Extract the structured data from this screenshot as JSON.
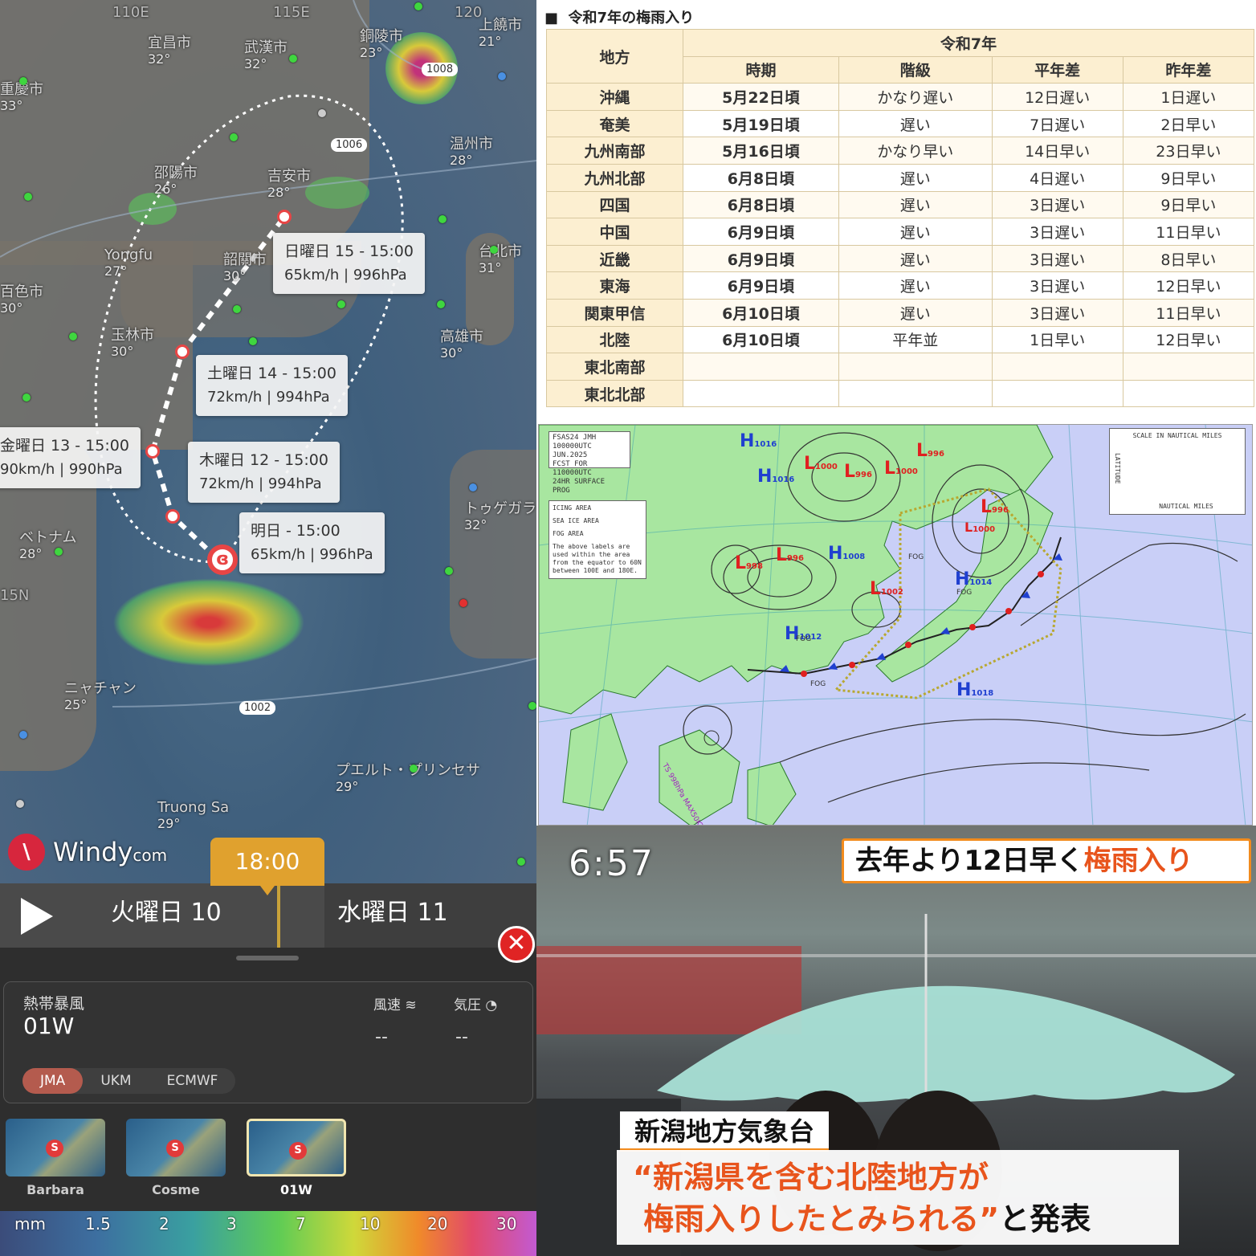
{
  "windy": {
    "map_labels": [
      {
        "name": "宜昌市",
        "temp": "32°"
      },
      {
        "name": "武漢市",
        "temp": "32°"
      },
      {
        "name": "銅陵市",
        "temp": "23°"
      },
      {
        "name": "上饒市",
        "temp": "21°"
      },
      {
        "name": "重慶市",
        "temp": "33°"
      },
      {
        "name": "邵陽市",
        "temp": "26°"
      },
      {
        "name": "吉安市",
        "temp": "28°"
      },
      {
        "name": "温州市",
        "temp": "28°"
      },
      {
        "name": "Yongfu",
        "temp": "27°"
      },
      {
        "name": "韶關市",
        "temp": "30°"
      },
      {
        "name": "台北市",
        "temp": "31°"
      },
      {
        "name": "百色市",
        "temp": "30°"
      },
      {
        "name": "玉林市",
        "temp": "30°"
      },
      {
        "name": "高雄市",
        "temp": "30°"
      },
      {
        "name": "トゥゲガラ",
        "temp": "32°"
      },
      {
        "name": "ベトナム",
        "temp": "28°"
      },
      {
        "name": "ニャチャン",
        "temp": "25°"
      },
      {
        "name": "Truong Sa",
        "temp": "29°"
      },
      {
        "name": "プエルト・プリンセサ",
        "temp": "29°"
      }
    ],
    "coords": {
      "lon1": "110E",
      "lon2": "115E",
      "lon3": "120",
      "lat": "15N"
    },
    "isobars": [
      "1008",
      "1006",
      "1002"
    ],
    "forecasts": [
      {
        "when": "日曜日 15 - 15:00",
        "detail": "65km/h | 996hPa"
      },
      {
        "when": "土曜日 14 - 15:00",
        "detail": "72km/h | 994hPa"
      },
      {
        "when": "金曜日 13 - 15:00",
        "detail": "90km/h | 990hPa"
      },
      {
        "when": "木曜日 12 - 15:00",
        "detail": "72km/h | 994hPa"
      },
      {
        "when": "明日 - 15:00",
        "detail": "65km/h | 996hPa"
      }
    ],
    "logo": {
      "main": "Windy",
      "suffix": "com"
    },
    "time_pill": "18:00",
    "days": [
      "火曜日 10",
      "水曜日 11"
    ],
    "storm": {
      "type_label": "熱帯暴風",
      "name": "01W",
      "wind_label": "風速",
      "wind_value": "--",
      "pressure_label": "気圧",
      "pressure_value": "--"
    },
    "models": [
      "JMA",
      "UKM",
      "ECMWF"
    ],
    "active_model": "JMA",
    "storms": [
      "Barbara",
      "Cosme",
      "01W"
    ],
    "active_storm": "01W",
    "legend": [
      "mm",
      "1.5",
      "2",
      "3",
      "7",
      "10",
      "20",
      "30"
    ]
  },
  "table": {
    "title": "令和7年の梅雨入り",
    "header_region": "地方",
    "header_year": "令和7年",
    "columns": [
      "時期",
      "階級",
      "平年差",
      "昨年差"
    ],
    "rows": [
      {
        "region": "沖縄",
        "date": "5月22日頃",
        "class": "かなり遅い",
        "normal": "12日遅い",
        "last": "1日遅い"
      },
      {
        "region": "奄美",
        "date": "5月19日頃",
        "class": "遅い",
        "normal": "7日遅い",
        "last": "2日早い"
      },
      {
        "region": "九州南部",
        "date": "5月16日頃",
        "class": "かなり早い",
        "normal": "14日早い",
        "last": "23日早い"
      },
      {
        "region": "九州北部",
        "date": "6月8日頃",
        "class": "遅い",
        "normal": "4日遅い",
        "last": "9日早い"
      },
      {
        "region": "四国",
        "date": "6月8日頃",
        "class": "遅い",
        "normal": "3日遅い",
        "last": "9日早い"
      },
      {
        "region": "中国",
        "date": "6月9日頃",
        "class": "遅い",
        "normal": "3日遅い",
        "last": "11日早い"
      },
      {
        "region": "近畿",
        "date": "6月9日頃",
        "class": "遅い",
        "normal": "3日遅い",
        "last": "8日早い"
      },
      {
        "region": "東海",
        "date": "6月9日頃",
        "class": "遅い",
        "normal": "3日遅い",
        "last": "12日早い"
      },
      {
        "region": "関東甲信",
        "date": "6月10日頃",
        "class": "遅い",
        "normal": "3日遅い",
        "last": "11日早い"
      },
      {
        "region": "北陸",
        "date": "6月10日頃",
        "class": "平年並",
        "normal": "1日早い",
        "last": "12日早い"
      },
      {
        "region": "東北南部",
        "date": "",
        "class": "",
        "normal": "",
        "last": ""
      },
      {
        "region": "東北北部",
        "date": "",
        "class": "",
        "normal": "",
        "last": ""
      }
    ]
  },
  "weather_map": {
    "header_lines": [
      "FSAS24 JMH",
      "100000UTC JUN.2025",
      "FCST FOR 110000UTC",
      "24HR SURFACE PROG"
    ],
    "legend_items": [
      "ICING AREA",
      "SEA ICE AREA",
      "FOG AREA"
    ],
    "legend_note": "The above labels are used within the area from the equator to 60N between 100E and 180E.",
    "scale_title": "SCALE IN NAUTICAL MILES",
    "scale_axis": "NAUTICAL MILES",
    "scale_lat": "LATITUDE",
    "systems": [
      {
        "type": "H",
        "pressure": "1016"
      },
      {
        "type": "H",
        "pressure": "1016"
      },
      {
        "type": "L",
        "pressure": "1000"
      },
      {
        "type": "L",
        "pressure": "996"
      },
      {
        "type": "L",
        "pressure": "1000"
      },
      {
        "type": "L",
        "pressure": "996"
      },
      {
        "type": "L",
        "pressure": "996"
      },
      {
        "type": "L",
        "pressure": "1000"
      },
      {
        "type": "L",
        "pressure": "996"
      },
      {
        "type": "L",
        "pressure": "998"
      },
      {
        "type": "H",
        "pressure": "1008"
      },
      {
        "type": "L",
        "pressure": "1002"
      },
      {
        "type": "H",
        "pressure": "1014"
      },
      {
        "type": "H",
        "pressure": "1012"
      },
      {
        "type": "H",
        "pressure": "1018"
      }
    ],
    "fog_label": "FOG",
    "ts_label": "TS 998hPa MAX50KT"
  },
  "tv": {
    "time": "6:57",
    "headline_plain": "去年より12日早く",
    "headline_highlight": "梅雨入り",
    "org": "新潟地方気象台",
    "quote_line1": "“新潟県を含む北陸地方が",
    "quote_line2": "梅雨入りしたとみられる”",
    "quote_tail": "と発表"
  },
  "colors": {
    "windy_accent": "#e0a12e",
    "model_active": "#b45b4e",
    "table_header": "#fcefd1",
    "tv_accent": "#f28b1d",
    "tv_highlight": "#e8541c",
    "front_cold": "#2040d0",
    "front_warm": "#e02020",
    "high": "#2040d0",
    "low": "#e02020"
  }
}
